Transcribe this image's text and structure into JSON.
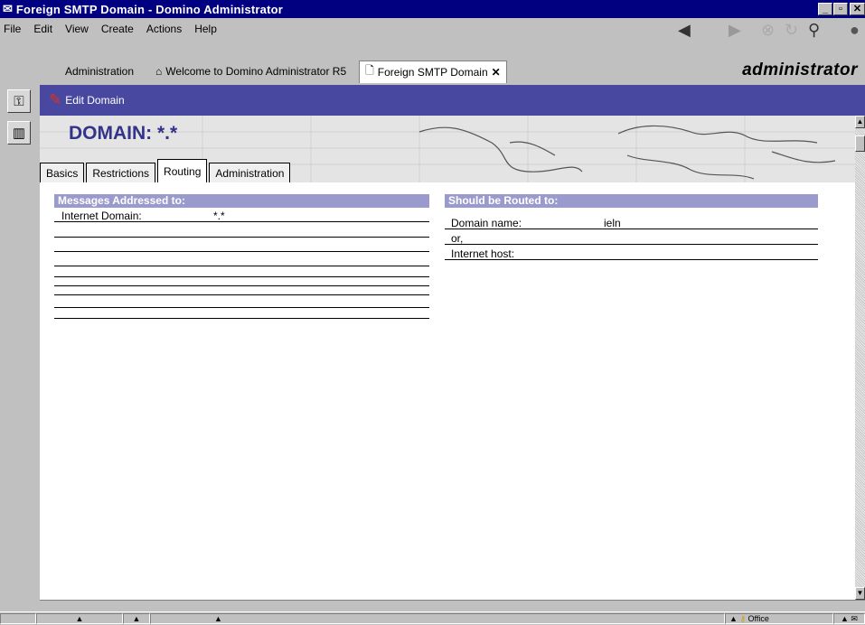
{
  "window": {
    "title": "Foreign SMTP Domain - Domino Administrator"
  },
  "menu": [
    "File",
    "Edit",
    "View",
    "Create",
    "Actions",
    "Help"
  ],
  "window_tabs": [
    {
      "label": "Administration"
    },
    {
      "label": "Welcome to Domino Administrator R5"
    },
    {
      "label": "Foreign SMTP Domain"
    }
  ],
  "brand": "administrator",
  "action_bar": {
    "edit_label": "Edit Domain"
  },
  "domain": {
    "heading": "DOMAIN:",
    "value": "*.*"
  },
  "form_tabs": [
    "Basics",
    "Restrictions",
    "Routing",
    "Administration"
  ],
  "left_section": {
    "header": "Messages Addressed to:",
    "fields": [
      {
        "label": "Internet Domain:",
        "value": "*.*"
      }
    ]
  },
  "right_section": {
    "header": "Should be Routed to:",
    "fields": [
      {
        "label": "Domain name:",
        "value": "ieln"
      },
      {
        "label": "or,",
        "value": ""
      },
      {
        "label": "Internet host:",
        "value": ""
      }
    ]
  },
  "status_bar": {
    "location": "Office"
  },
  "icons": {
    "nav_back": "arrow-left-icon",
    "nav_forward": "arrow-right-icon",
    "stop": "stop-icon",
    "refresh": "refresh-icon",
    "search": "search-icon",
    "edit": "pencil-icon"
  }
}
